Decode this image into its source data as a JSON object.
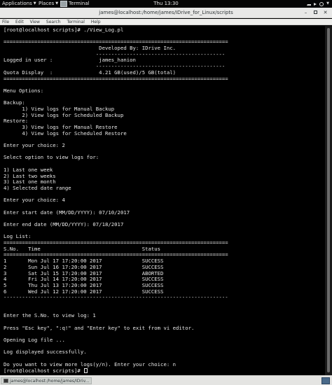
{
  "topbar": {
    "applications_label": "Applications",
    "places_label": "Places",
    "terminal_task_label": "Terminal",
    "clock": "Thu 13:30"
  },
  "window": {
    "title": "james@localhost:/home/james/IDrive_for_Linux/scripts",
    "minimize_glyph": "–",
    "close_glyph": "✕"
  },
  "menubar": {
    "items": [
      "File",
      "Edit",
      "View",
      "Search",
      "Terminal",
      "Help"
    ]
  },
  "terminal": {
    "lines": [
      "[root@localhost scripts]# ./View_Log.pl",
      "",
      "=========================================================================",
      "                               Developed By: IDrive Inc.",
      "                              ------------------------------------------",
      "Logged in user :               james_hanion",
      "                              ------------------------------------------",
      "Quota Display  :               4.21 GB(used)/5 GB(total)",
      "=========================================================================",
      "",
      "Menu Options:",
      "",
      "Backup:",
      "      1) View logs for Manual Backup",
      "      2) View logs for Scheduled Backup",
      "Restore:",
      "      3) View logs for Manual Restore",
      "      4) View logs for Scheduled Restore",
      "",
      "Enter your choice: 2",
      "",
      "Select option to view logs for:",
      "",
      "1) Last one week",
      "2) Last two weeks",
      "3) Last one month",
      "4) Selected date range",
      "",
      "Enter your choice: 4",
      "",
      "Enter start date (MM/DD/YYYY): 07/10/2017",
      "",
      "Enter end date (MM/DD/YYYY): 07/18/2017",
      "",
      "Log List:",
      "=========================================================================",
      "S.No.   Time                                 Status",
      "=========================================================================",
      "1       Mon Jul 17 17:20:00 2017             SUCCESS",
      "2       Sun Jul 16 17:20:00 2017             SUCCESS",
      "3       Sat Jul 15 17:20:00 2017             ABORTED",
      "4       Fri Jul 14 17:20:00 2017             SUCCESS",
      "5       Thu Jul 13 17:20:00 2017             SUCCESS",
      "6       Wed Jul 12 17:20:00 2017             SUCCESS",
      "-------------------------------------------------------------------------",
      "",
      "",
      "Enter the S.No. to view log: 1",
      "",
      "Press \"Esc key\", \":q!\" and \"Enter key\" to exit from vi editor.",
      "",
      "Opening Log file ...",
      "",
      "Log displayed successfully.",
      "",
      "Do you want to view more logs(y/n). Enter your choice: n",
      "[root@localhost scripts]# "
    ]
  },
  "bottombar": {
    "task_label": "james@localhost:/home/james/IDriv..."
  }
}
